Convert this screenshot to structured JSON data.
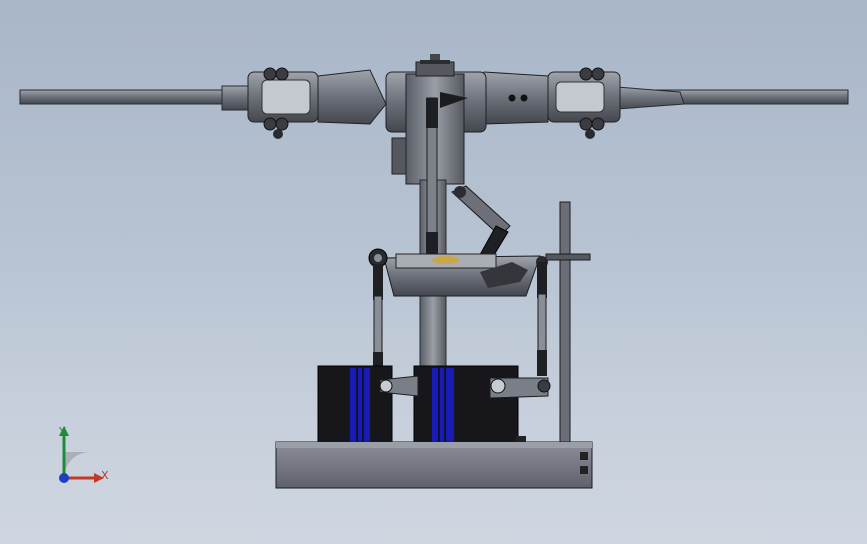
{
  "viewport": {
    "background_top": "#a9b6c8",
    "background_bottom": "#cfd6e0"
  },
  "model": {
    "description_icon": "helicopter-rotor-head-assembly",
    "metal_color": "#6f737c",
    "dark_color": "#1b1b1f",
    "accent_blue": "#2a2ad0"
  },
  "triad": {
    "x_label": "X",
    "y_label": "Y",
    "x_color": "#c0392b",
    "y_color": "#1e8a3a",
    "z_color": "#1f3fbf"
  }
}
